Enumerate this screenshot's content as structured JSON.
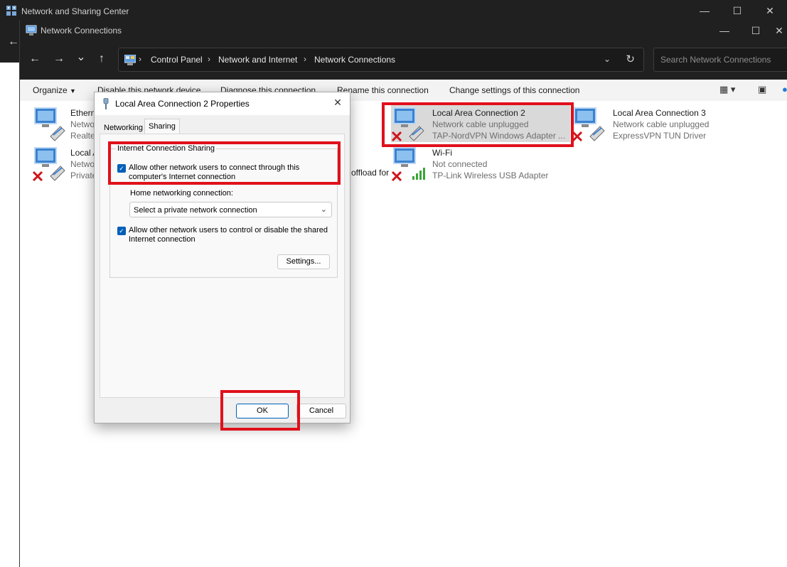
{
  "back_window": {
    "title": "Network and Sharing Center",
    "controls": {
      "minimize": "—",
      "maximize": "☐",
      "close": "✕"
    },
    "back_arrow": "←"
  },
  "window": {
    "title": "Network Connections",
    "controls": {
      "minimize": "—",
      "maximize": "☐",
      "close": "✕"
    }
  },
  "nav": {
    "back": "←",
    "forward": "→",
    "recent": "⌄",
    "up": "↑",
    "breadcrumb": [
      "Control Panel",
      "Network and Internet",
      "Network Connections"
    ],
    "separator": "›",
    "dropdown": "⌄",
    "refresh": "↻",
    "search_placeholder": "Search Network Connections"
  },
  "command_bar": {
    "organize": "Organize",
    "disable": "Disable this network device",
    "diagnose": "Diagnose this connection",
    "rename": "Rename this connection",
    "change_settings": "Change settings of this connection"
  },
  "connections": [
    {
      "name": "Ethernet",
      "status": "Network",
      "adapter": "Realtek"
    },
    {
      "name": "Local Area Connection",
      "status": "Network",
      "adapter": "Private",
      "extra": "offload for"
    },
    {
      "name": "Local Area Connection 2",
      "status": "Network cable unplugged",
      "adapter": "TAP-NordVPN Windows Adapter ..."
    },
    {
      "name": "Wi-Fi",
      "status": "Not connected",
      "adapter": "TP-Link Wireless USB Adapter"
    },
    {
      "name": "Local Area Connection 3",
      "status": "Network cable unplugged",
      "adapter": "ExpressVPN TUN Driver"
    }
  ],
  "dialog": {
    "title": "Local Area Connection 2 Properties",
    "close": "✕",
    "tabs": [
      "Networking",
      "Sharing"
    ],
    "active_tab": "Sharing",
    "group_title": "Internet Connection Sharing",
    "allow_connect": "Allow other network users to connect through this computer's Internet connection",
    "home_label": "Home networking connection:",
    "home_select": "Select a private network connection",
    "allow_control": "Allow other network users to control or disable the shared Internet connection",
    "settings_button": "Settings...",
    "ok_button": "OK",
    "cancel_button": "Cancel",
    "check": "✓",
    "chevron": "⌄"
  },
  "colors": {
    "accent": "#005fb8",
    "annotation": "#e0101b",
    "titlebar_dark": "#202020",
    "selection": "#d9d9d9"
  }
}
